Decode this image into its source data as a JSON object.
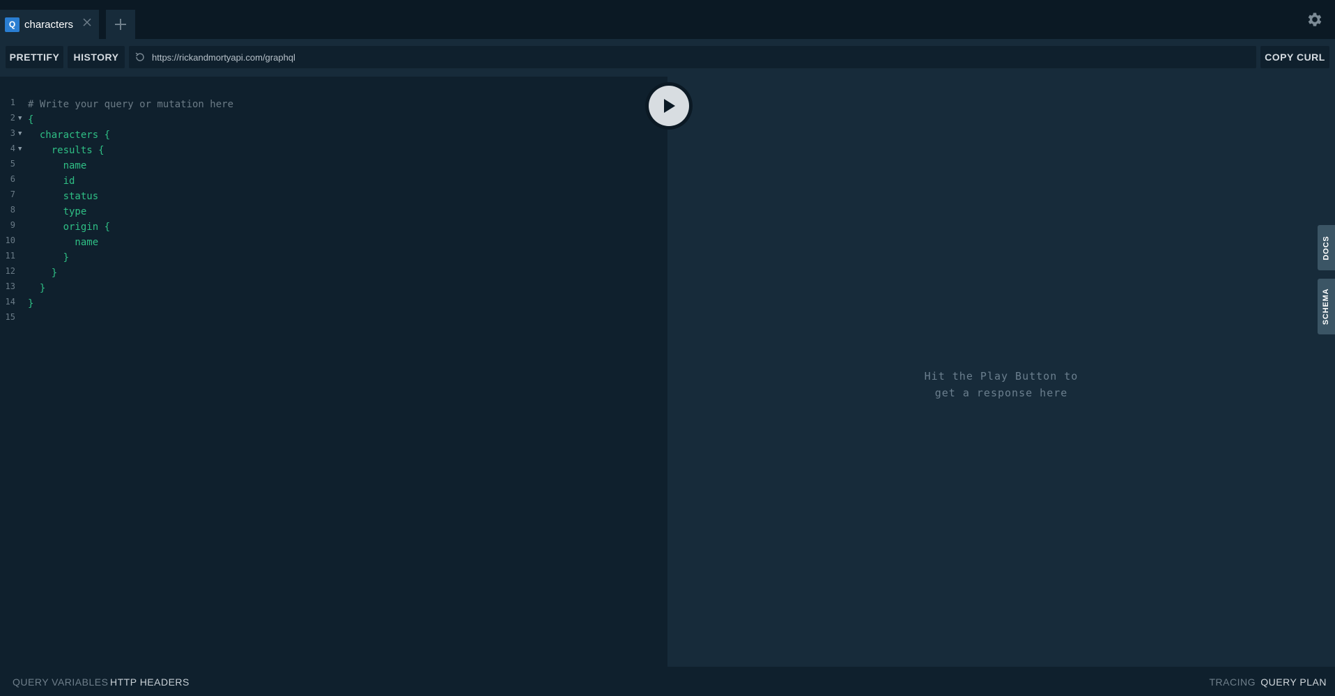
{
  "tab": {
    "icon_letter": "Q",
    "title": "characters"
  },
  "toolbar": {
    "prettify": "PRETTIFY",
    "history": "HISTORY",
    "endpoint": "https://rickandmortyapi.com/graphql",
    "copy_curl": "COPY CURL"
  },
  "editor": {
    "lines": [
      {
        "n": "1",
        "text": "# Write your query or mutation here"
      },
      {
        "n": "2",
        "text": "{"
      },
      {
        "n": "3",
        "text": "  characters {"
      },
      {
        "n": "4",
        "text": "    results {"
      },
      {
        "n": "5",
        "text": "      name"
      },
      {
        "n": "6",
        "text": "      id"
      },
      {
        "n": "7",
        "text": "      status"
      },
      {
        "n": "8",
        "text": "      type"
      },
      {
        "n": "9",
        "text": "      origin {"
      },
      {
        "n": "10",
        "text": "        name"
      },
      {
        "n": "11",
        "text": "      }"
      },
      {
        "n": "12",
        "text": "    }"
      },
      {
        "n": "13",
        "text": "  }"
      },
      {
        "n": "14",
        "text": "}"
      },
      {
        "n": "15",
        "text": ""
      }
    ]
  },
  "result": {
    "hint_line1": "Hit the Play Button to",
    "hint_line2": "get a response here"
  },
  "side_tabs": {
    "docs": "DOCS",
    "schema": "SCHEMA"
  },
  "footer": {
    "query_variables": "QUERY VARIABLES",
    "http_headers": "HTTP HEADERS",
    "tracing": "TRACING",
    "query_plan": "QUERY PLAN"
  },
  "colors": {
    "keyword": "#2fbf85",
    "comment": "#6b7b86",
    "accent": "#2a7ed2"
  },
  "icons": [
    "close-icon",
    "plus-icon",
    "settings-gear-icon",
    "reload-icon",
    "play-icon",
    "fold-arrow-icon"
  ]
}
